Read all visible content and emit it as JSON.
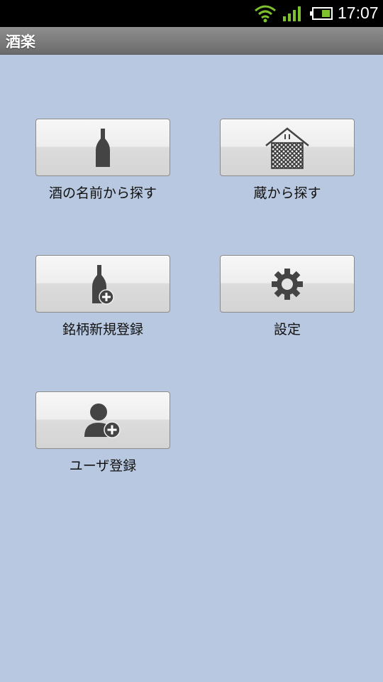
{
  "status_bar": {
    "time": "17:07"
  },
  "app": {
    "title": "酒楽"
  },
  "menu": {
    "sake_search": "酒の名前から探す",
    "brewery_search": "蔵から探す",
    "register_brand": "銘柄新規登録",
    "settings": "設定",
    "register_user": "ユーザ登録"
  },
  "colors": {
    "background": "#b8c8e0",
    "icon": "#444444",
    "status_green": "#7dc12e"
  }
}
